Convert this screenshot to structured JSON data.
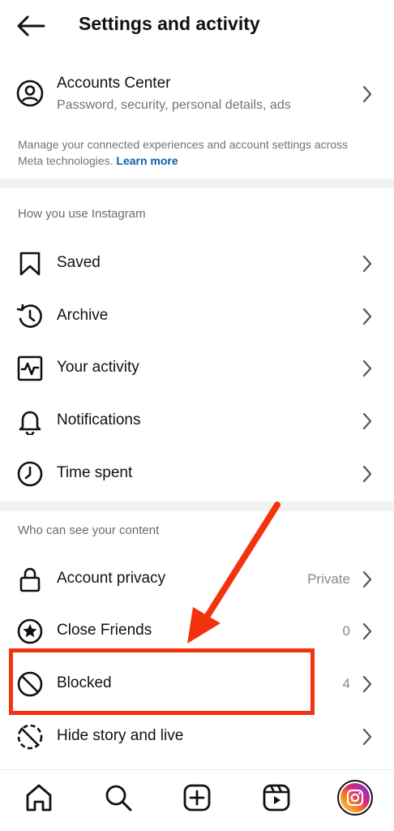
{
  "header": {
    "title": "Settings and activity"
  },
  "accounts_center": {
    "title": "Accounts Center",
    "subtitle": "Password, security, personal details, ads",
    "description": "Manage your connected experiences and account settings across Meta technologies.",
    "learn_more": "Learn more"
  },
  "section_usage": {
    "heading": "How you use Instagram",
    "items": [
      {
        "label": "Saved",
        "icon": "bookmark-icon"
      },
      {
        "label": "Archive",
        "icon": "archive-icon"
      },
      {
        "label": "Your activity",
        "icon": "activity-icon"
      },
      {
        "label": "Notifications",
        "icon": "bell-icon"
      },
      {
        "label": "Time spent",
        "icon": "clock-icon"
      }
    ]
  },
  "section_visibility": {
    "heading": "Who can see your content",
    "items": [
      {
        "label": "Account privacy",
        "value": "Private",
        "icon": "lock-icon"
      },
      {
        "label": "Close Friends",
        "value": "0",
        "icon": "star-circle-icon"
      },
      {
        "label": "Blocked",
        "value": "4",
        "icon": "blocked-icon"
      },
      {
        "label": "Hide story and live",
        "icon": "hide-story-icon"
      }
    ]
  },
  "bottom_nav": {
    "items": [
      "home-icon",
      "search-icon",
      "create-icon",
      "reels-icon",
      "profile-avatar"
    ]
  },
  "colors": {
    "annotation": "#f2330e",
    "link": "#0a5fa8"
  }
}
